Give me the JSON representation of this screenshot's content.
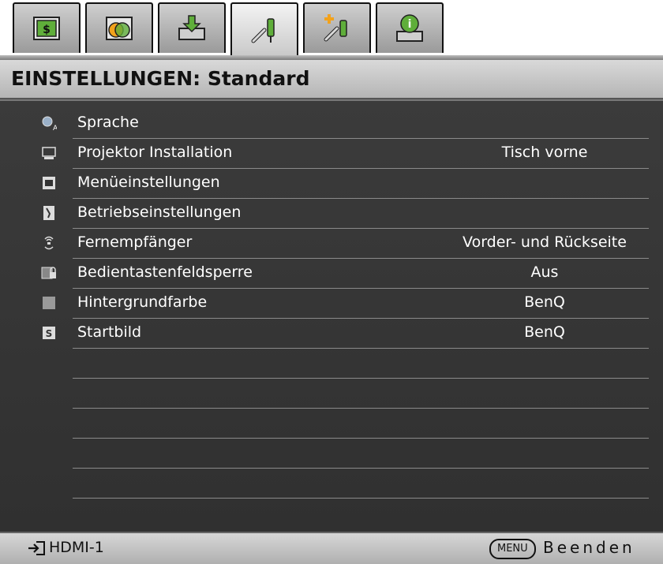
{
  "tabs": [
    {
      "name": "picture",
      "icon": "picture-tab-icon"
    },
    {
      "name": "picture-advanced",
      "icon": "picture-advanced-tab-icon"
    },
    {
      "name": "display",
      "icon": "display-tab-icon"
    },
    {
      "name": "settings-basic",
      "icon": "settings-basic-tab-icon",
      "active": true
    },
    {
      "name": "settings-advanced",
      "icon": "settings-advanced-tab-icon"
    },
    {
      "name": "information",
      "icon": "information-tab-icon"
    }
  ],
  "header": {
    "title": "EINSTELLUNGEN: Standard"
  },
  "menu": {
    "items": [
      {
        "label": "Sprache",
        "value": "",
        "icon": "language-icon"
      },
      {
        "label": "Projektor Installation",
        "value": "Tisch vorne",
        "icon": "projector-install-icon"
      },
      {
        "label": "Menüeinstellungen",
        "value": "",
        "icon": "menu-settings-icon"
      },
      {
        "label": "Betriebseinstellungen",
        "value": "",
        "icon": "operation-settings-icon"
      },
      {
        "label": "Fernempfänger",
        "value": "Vorder- und Rückseite",
        "icon": "remote-receiver-icon"
      },
      {
        "label": "Bedientastenfeldsperre",
        "value": "Aus",
        "icon": "keypad-lock-icon"
      },
      {
        "label": "Hintergrundfarbe",
        "value": "BenQ",
        "icon": "background-color-icon"
      },
      {
        "label": "Startbild",
        "value": "BenQ",
        "icon": "splash-screen-icon"
      }
    ]
  },
  "footer": {
    "source": "HDMI-1",
    "menu_key": "MENU",
    "exit": "Beenden"
  },
  "colors": {
    "accent_green": "#7cc142",
    "menu_bg": "#363636",
    "divider": "#8a8a8a"
  }
}
